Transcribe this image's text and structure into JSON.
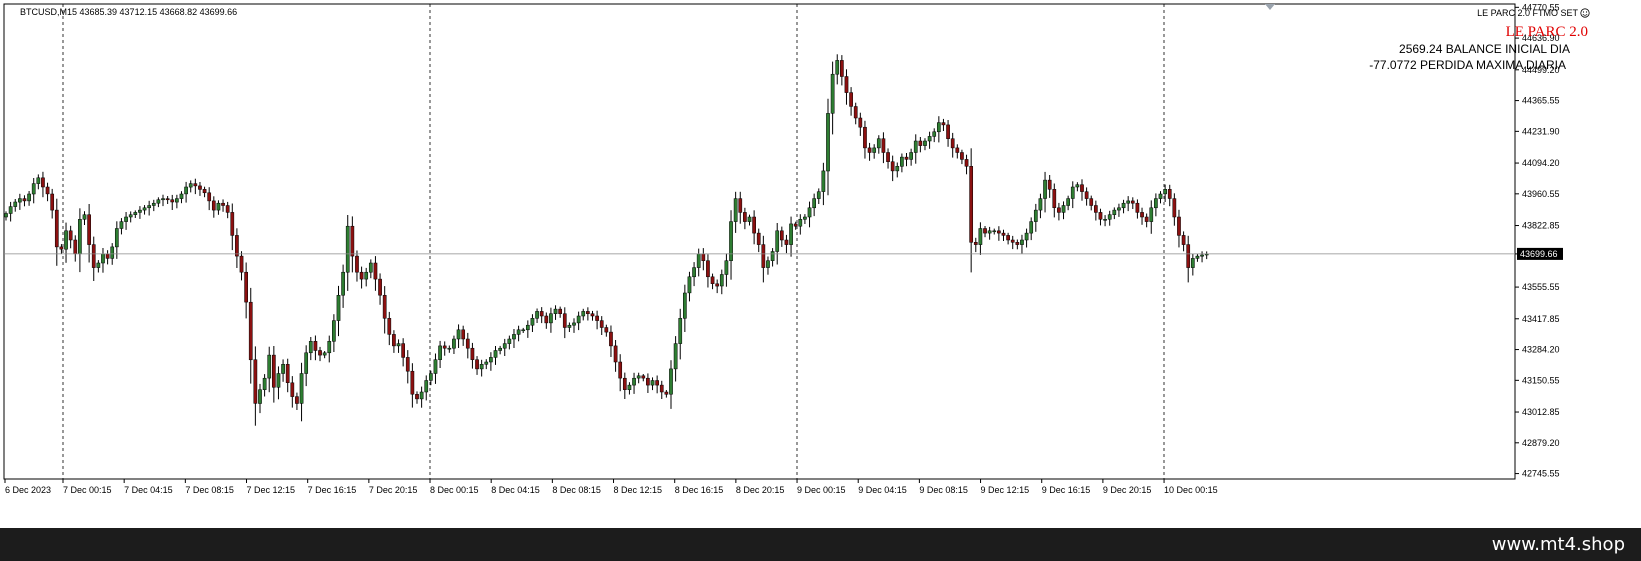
{
  "header": {
    "symbol_line": "BTCUSD,M15  43685.39 43712.15 43668.82 43699.66"
  },
  "indicator": {
    "name_line": "LE PARC 2.0 FTMO SET",
    "title": "LE PARC 2.0",
    "balance_line": "2569.24 BALANCE INICIAL DIA",
    "loss_line": "-77.0772 PERDIDA MAXIMA DIARIA",
    "title_color": "#e00000"
  },
  "footer": {
    "text": "www.mt4.shop"
  },
  "chart_data": {
    "type": "candlestick",
    "symbol": "BTCUSD",
    "timeframe": "M15",
    "ohlc": {
      "open": 43685.39,
      "high": 43712.15,
      "low": 43668.82,
      "close": 43699.66
    },
    "current_price": 43699.66,
    "ylim": [
      42722,
      44785
    ],
    "y_ticks": [
      44770.55,
      44636.9,
      44499.2,
      44365.55,
      44231.9,
      44094.2,
      43960.55,
      43822.85,
      43699.66,
      43555.55,
      43417.85,
      43284.2,
      43150.55,
      43012.85,
      42879.2,
      42745.55
    ],
    "x_ticks": [
      "6 Dec 2023",
      "7 Dec 00:15",
      "7 Dec 04:15",
      "7 Dec 08:15",
      "7 Dec 12:15",
      "7 Dec 16:15",
      "7 Dec 20:15",
      "8 Dec 00:15",
      "8 Dec 04:15",
      "8 Dec 08:15",
      "8 Dec 12:15",
      "8 Dec 16:15",
      "8 Dec 20:15",
      "9 Dec 00:15",
      "9 Dec 04:15",
      "9 Dec 08:15",
      "9 Dec 12:15",
      "9 Dec 16:15",
      "9 Dec 20:15",
      "10 Dec 00:15"
    ],
    "closes": [
      43875,
      43905,
      43925,
      43940,
      43930,
      43960,
      44005,
      44030,
      43990,
      43960,
      43890,
      43730,
      43720,
      43800,
      43760,
      43700,
      43850,
      43870,
      43740,
      43640,
      43660,
      43700,
      43680,
      43730,
      43810,
      43840,
      43860,
      43870,
      43880,
      43890,
      43900,
      43910,
      43920,
      43935,
      43940,
      43935,
      43925,
      43940,
      43960,
      43990,
      44005,
      43995,
      43980,
      43965,
      43930,
      43890,
      43920,
      43910,
      43880,
      43780,
      43690,
      43620,
      43490,
      43240,
      43050,
      43110,
      43160,
      43260,
      43120,
      43180,
      43220,
      43140,
      43080,
      43050,
      43180,
      43270,
      43320,
      43280,
      43260,
      43270,
      43320,
      43410,
      43520,
      43620,
      43820,
      43690,
      43620,
      43590,
      43620,
      43660,
      43590,
      43520,
      43420,
      43350,
      43300,
      43310,
      43250,
      43190,
      43090,
      43070,
      43100,
      43150,
      43180,
      43240,
      43300,
      43290,
      43290,
      43330,
      43370,
      43330,
      43290,
      43240,
      43200,
      43220,
      43230,
      43250,
      43280,
      43290,
      43310,
      43330,
      43350,
      43370,
      43370,
      43390,
      43420,
      43450,
      43430,
      43400,
      43440,
      43460,
      43440,
      43380,
      43390,
      43400,
      43430,
      43450,
      43440,
      43430,
      43410,
      43380,
      43360,
      43300,
      43230,
      43160,
      43110,
      43130,
      43160,
      43170,
      43160,
      43130,
      43150,
      43130,
      43100,
      43090,
      43200,
      43310,
      43420,
      43530,
      43600,
      43640,
      43700,
      43670,
      43600,
      43570,
      43560,
      43610,
      43670,
      43840,
      43940,
      43880,
      43840,
      43860,
      43790,
      43740,
      43640,
      43670,
      43710,
      43800,
      43760,
      43740,
      43830,
      43820,
      43850,
      43860,
      43900,
      43940,
      43970,
      44060,
      44310,
      44480,
      44540,
      44470,
      44400,
      44340,
      44290,
      44250,
      44160,
      44140,
      44160,
      44200,
      44140,
      44100,
      44060,
      44080,
      44120,
      44110,
      44140,
      44190,
      44170,
      44190,
      44210,
      44230,
      44270,
      44260,
      44200,
      44160,
      44140,
      44110,
      44080,
      43750,
      43740,
      43810,
      43790,
      43800,
      43800,
      43790,
      43780,
      43760,
      43750,
      43740,
      43760,
      43790,
      43840,
      43890,
      43940,
      44020,
      43980,
      43900,
      43880,
      43910,
      43940,
      43990,
      44000,
      43970,
      43940,
      43910,
      43880,
      43850,
      43850,
      43870,
      43890,
      43900,
      43920,
      43930,
      43920,
      43880,
      43860,
      43840,
      43900,
      43940,
      43960,
      43980,
      43940,
      43860,
      43780,
      43740,
      43640,
      43680,
      43690,
      43695,
      43700
    ]
  }
}
